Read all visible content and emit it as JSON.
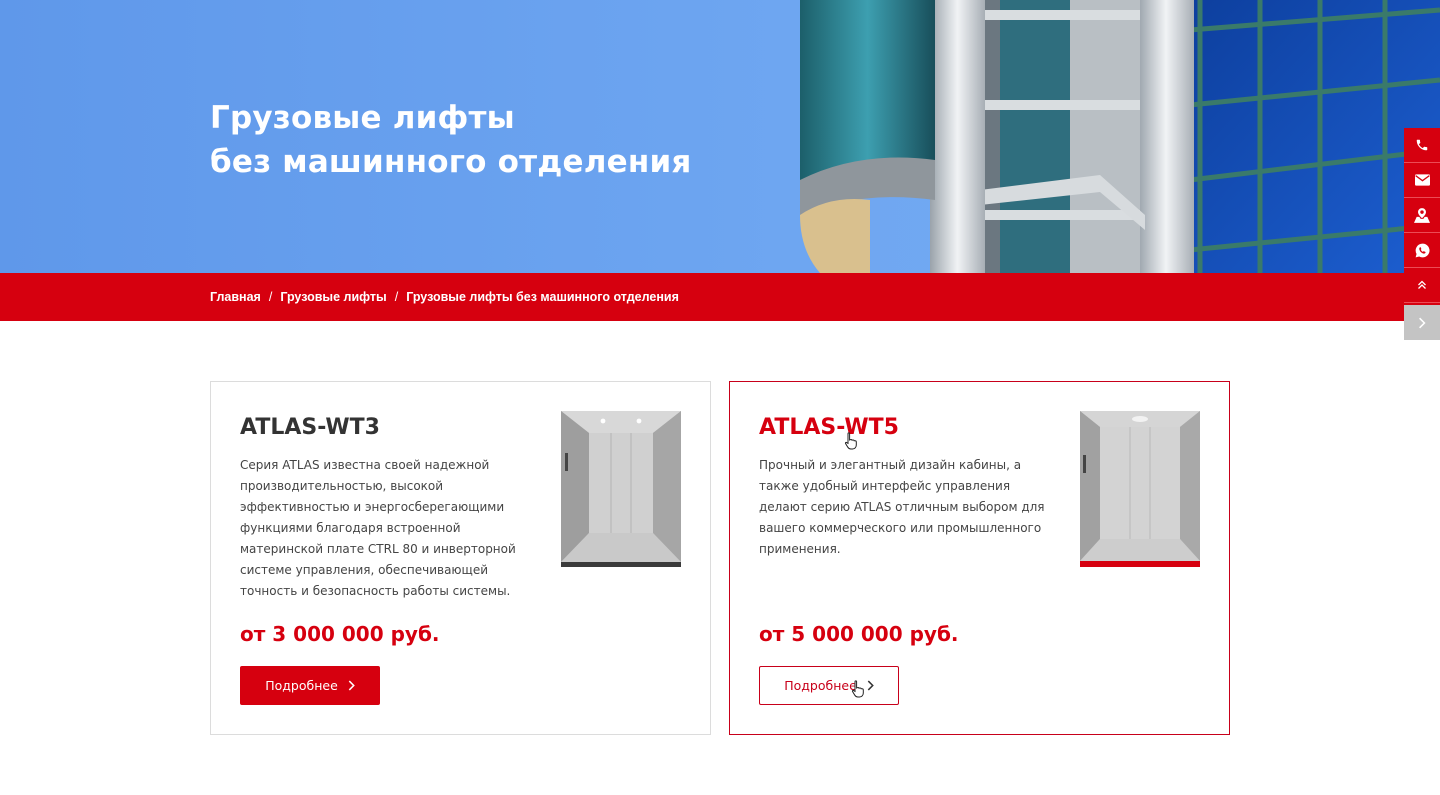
{
  "hero": {
    "title_line1": "Грузовые лифты",
    "title_line2": "без машинного отделения"
  },
  "breadcrumb": {
    "items": [
      "Главная",
      "Грузовые лифты",
      "Грузовые лифты без машинного отделения"
    ],
    "separator": "/"
  },
  "sidebar": {
    "buttons": [
      "phone-icon",
      "mail-icon",
      "map-icon",
      "whatsapp-icon",
      "scroll-top-icon",
      "expand-icon"
    ]
  },
  "cards": [
    {
      "title": "ATLAS-WT3",
      "description": "Серия ATLAS известна своей надежной производительностью, высокой эффективностью и энергосберегающими функциями благодаря встроенной материнской плате CTRL 80 и инверторной системе управления, обеспечивающей точность и безопасность работы системы.",
      "price": "от 3 000 000 руб.",
      "button_label": "Подробнее"
    },
    {
      "title": "ATLAS-WT5",
      "description": "Прочный и элегантный дизайн кабины, а также удобный интерфейс управления делают серию ATLAS отличным выбором для вашего коммерческого или промышленного применения.",
      "price": "от 5 000 000 руб.",
      "button_label": "Подробнее"
    }
  ],
  "colors": {
    "brand_red": "#d6000f",
    "hero_blue": "#6aa2ef",
    "side_gray": "#c4c4c4"
  }
}
